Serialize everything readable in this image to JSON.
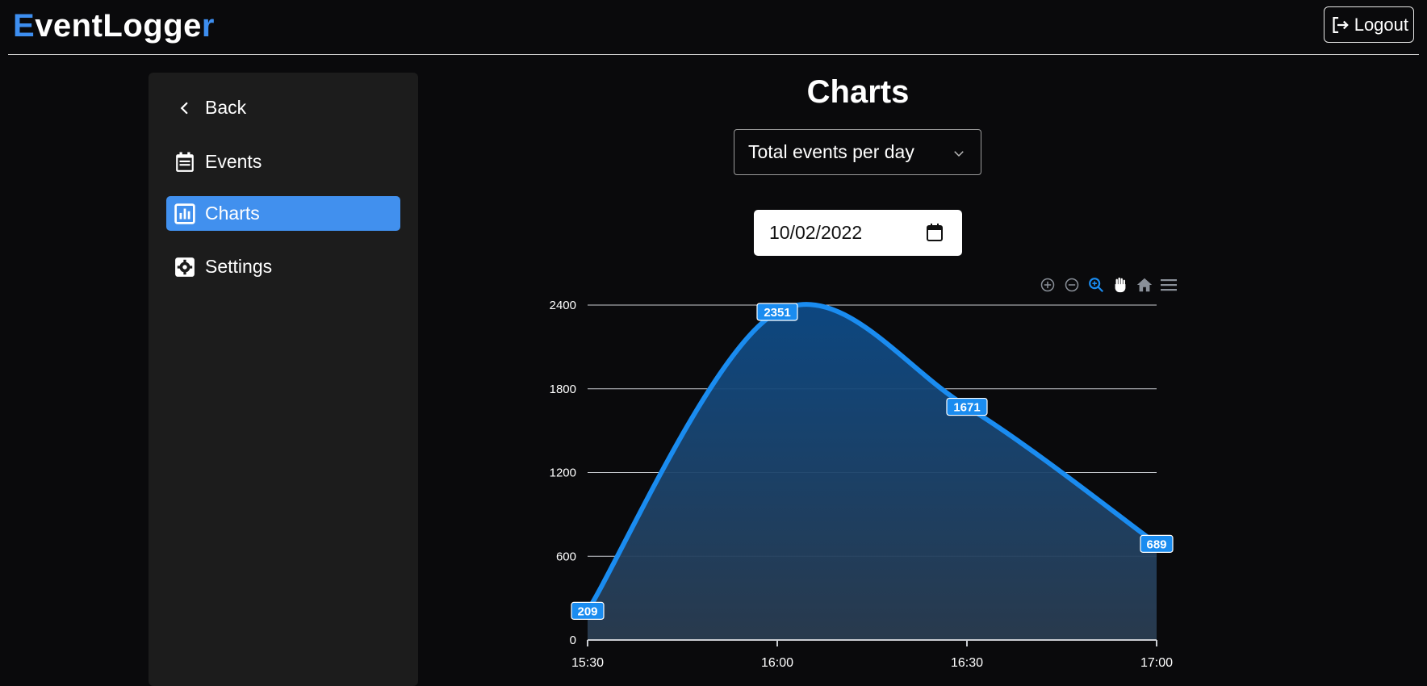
{
  "header": {
    "brand_first": "E",
    "brand_middle": "ventLogge",
    "brand_last": "r",
    "logout_label": "Logout"
  },
  "sidebar": {
    "items": [
      {
        "label": "Back",
        "icon": "chevron-left-icon",
        "active": false
      },
      {
        "label": "Events",
        "icon": "calendar-icon",
        "active": false
      },
      {
        "label": "Charts",
        "icon": "bar-chart-icon",
        "active": true
      },
      {
        "label": "Settings",
        "icon": "gear-icon",
        "active": false
      }
    ]
  },
  "main": {
    "title": "Charts",
    "chart_select": {
      "value": "Total events per day"
    },
    "date_input": {
      "value": "10/02/2022"
    }
  },
  "colors": {
    "accent": "#4190ee",
    "series": "#1a8cf0",
    "background": "#0a0a0c",
    "sidebar": "#1c1c1c"
  },
  "toolbar": {
    "icons": [
      "zoom-in-icon",
      "zoom-out-icon",
      "zoom-selection-icon",
      "pan-hand-icon",
      "reset-home-icon",
      "menu-icon"
    ]
  },
  "chart_data": {
    "type": "area",
    "x": [
      "15:30",
      "16:00",
      "16:30",
      "17:00"
    ],
    "values": [
      209,
      2351,
      1671,
      689
    ],
    "y_ticks": [
      0,
      600,
      1200,
      1800,
      2400
    ],
    "ylim": [
      0,
      2400
    ],
    "grid": true,
    "data_labels": true,
    "smooth": true
  }
}
